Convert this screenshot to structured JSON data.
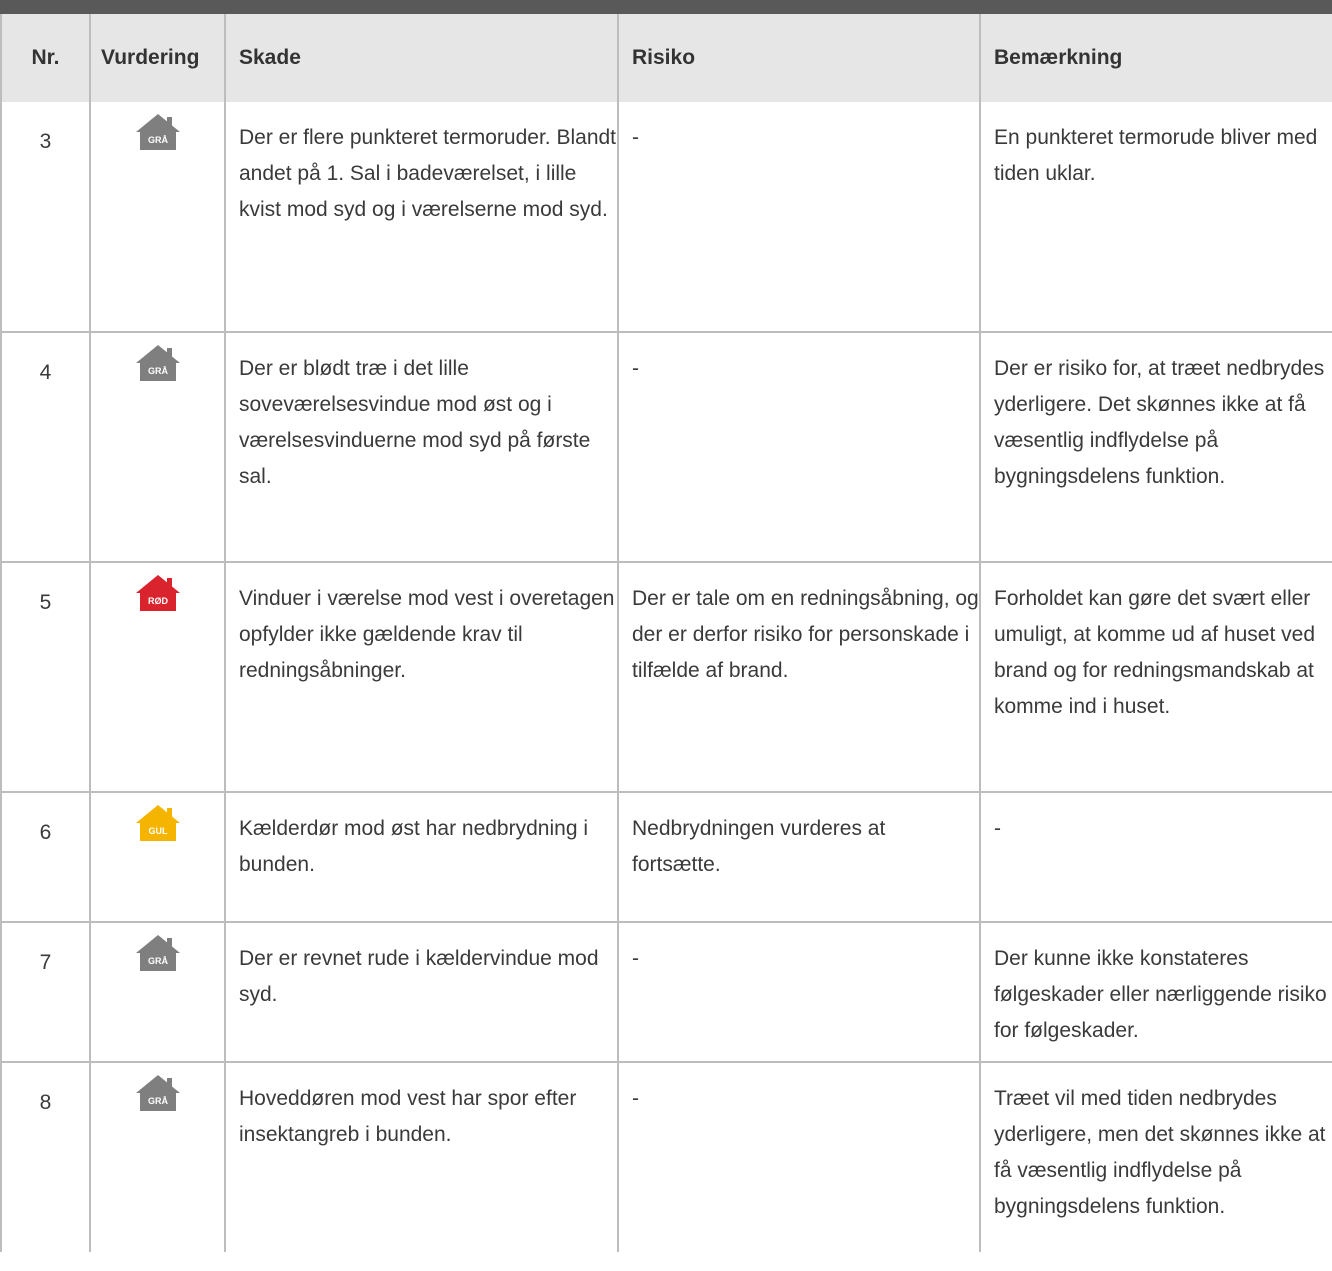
{
  "table": {
    "headers": [
      "Nr.",
      "Vurdering",
      "Skade",
      "Risiko",
      "Bemærkning"
    ],
    "rows": [
      {
        "nr": "3",
        "rating": "GRÅ",
        "rating_color": "#7f7f7f",
        "skade": "Der er flere punkteret termoruder. Blandt andet på 1. Sal i badeværelset, i lille kvist mod syd og i værelserne mod syd.",
        "risiko": "-",
        "bemaerkning": "En punkteret termorude bliver med tiden uklar."
      },
      {
        "nr": "4",
        "rating": "GRÅ",
        "rating_color": "#7f7f7f",
        "skade": "Der er blødt træ i det lille soveværelsesvindue mod øst og i værelsesvinduerne mod syd på første sal.",
        "risiko": "-",
        "bemaerkning": "Der er risiko for, at træet nedbrydes yderligere. Det skønnes ikke at få væsentlig indflydelse på bygningsdelens funktion."
      },
      {
        "nr": "5",
        "rating": "RØD",
        "rating_color": "#d9232d",
        "skade": "Vinduer i værelse mod vest i overetagen opfylder ikke gældende krav til redningsåbninger.",
        "risiko": "Der er tale om en redningsåbning, og der er derfor risiko for personskade i tilfælde af brand.",
        "bemaerkning": "Forholdet kan gøre det svært eller umuligt, at komme ud af huset ved brand og for redningsmandskab at komme ind i huset."
      },
      {
        "nr": "6",
        "rating": "GUL",
        "rating_color": "#f5b400",
        "skade": "Kælderdør mod øst har nedbrydning i bunden.",
        "risiko": "Nedbrydningen vurderes at fortsætte.",
        "bemaerkning": "-"
      },
      {
        "nr": "7",
        "rating": "GRÅ",
        "rating_color": "#7f7f7f",
        "skade": "Der er revnet rude i kældervindue mod syd.",
        "risiko": "-",
        "bemaerkning": "Der kunne ikke konstateres følgeskader eller nærliggende risiko for følgeskader."
      },
      {
        "nr": "8",
        "rating": "GRÅ",
        "rating_color": "#7f7f7f",
        "skade": "Hoveddøren mod vest har spor efter insektangreb i bunden.",
        "risiko": "-",
        "bemaerkning": "Træet vil med tiden nedbrydes yderligere, men det skønnes ikke at få væsentlig indflydelse på bygningsdelens funktion."
      }
    ]
  }
}
